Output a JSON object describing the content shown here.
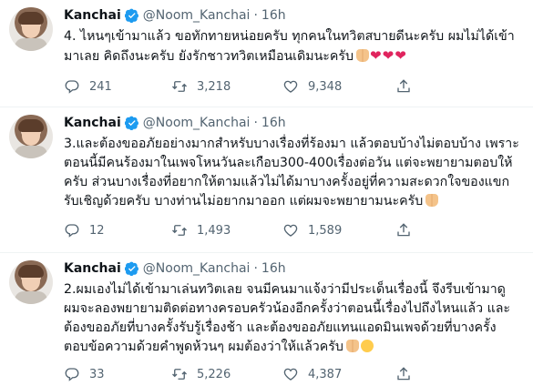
{
  "tweets": [
    {
      "name": "Kanchai",
      "handle": "@Noom_Kanchai",
      "separator": "·",
      "time": "16h",
      "text": "4. ไหนๆเข้ามาแล้ว ขอทักทายหน่อยครับ ทุกคนในทวิตสบายดีนะครับ ผมไม่ได้เข้ามาเลย คิดถึงนะครับ ยังรักชาวทวิตเหมือนเดิมนะครับ",
      "replies": "241",
      "retweets": "3,218",
      "likes": "9,348"
    },
    {
      "name": "Kanchai",
      "handle": "@Noom_Kanchai",
      "separator": "·",
      "time": "16h",
      "text": "3.และต้องขออภัยอย่างมากสำหรับบางเรื่องที่ร้องมา แล้วตอบบ้างไม่ตอบบ้าง เพราะตอนนี้มีคนร้องมาในเพจโหนวันละเกือบ300-400เรื่องต่อวัน แต่จะพยายามตอบให้ครับ ส่วนบางเรื่องที่อยากให้ตามแล้วไม่ได้มาบางครั้งอยู่ที่ความสะดวกใจของแขกรับเชิญด้วยครับ บางท่านไม่อยากมาออก แต่ผมจะพยายามนะครับ",
      "replies": "12",
      "retweets": "1,493",
      "likes": "1,589"
    },
    {
      "name": "Kanchai",
      "handle": "@Noom_Kanchai",
      "separator": "·",
      "time": "16h",
      "text": "2.ผมเองไม่ได้เข้ามาเล่นทวิตเลย จนมีคนมาแจ้งว่ามีประเด็นเรื่องนี้ จึงรีบเข้ามาดู ผมจะลองพยายามติดต่อทางครอบครัวน้องอีกครั้งว่าตอนนี้เรื่องไปถึงไหนแล้ว และต้องขออภัยที่บางครั้งรับรู้เรื่องช้า และต้องขออภัยแทนแอดมินเพจด้วยที่บางครั้งตอบข้อความด้วยคำพูดห้วนๆ ผมต้องว่าให้แล้วครับ",
      "replies": "33",
      "retweets": "5,226",
      "likes": "4,387"
    }
  ],
  "colors": {
    "verified": "#1d9bf0",
    "muted": "#536471",
    "heart": "#e0245e"
  },
  "icons": [
    "verified-badge-icon",
    "reply-icon",
    "retweet-icon",
    "like-icon",
    "share-icon"
  ]
}
